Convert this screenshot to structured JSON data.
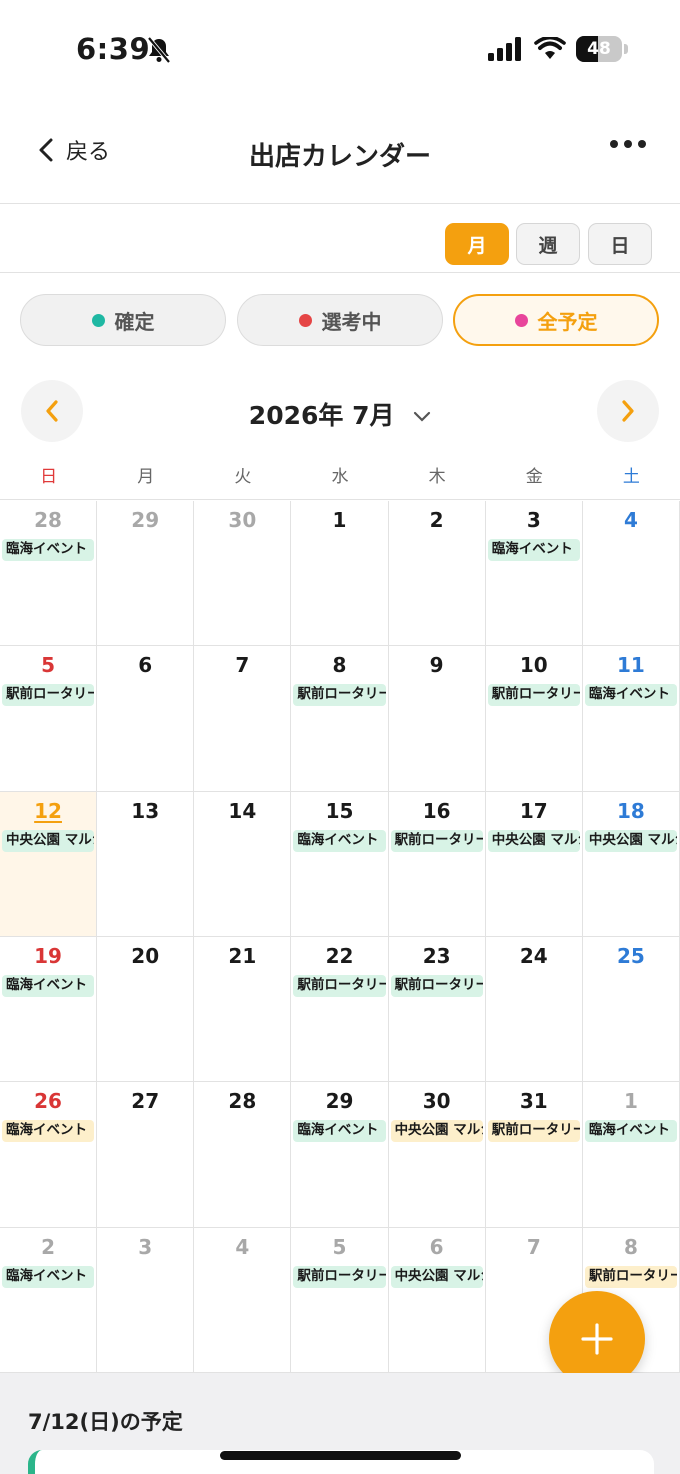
{
  "status_bar": {
    "time": "6:39",
    "battery": "48",
    "battery_level": 0.48
  },
  "nav": {
    "back_label": "戻る",
    "title": "出店カレンダー"
  },
  "view_switch": {
    "month": "月",
    "week": "週",
    "day": "日",
    "selected": "月"
  },
  "filters": [
    {
      "label": "確定",
      "color": "#1fb8a3",
      "active": false
    },
    {
      "label": "選考中",
      "color": "#e54545",
      "active": false
    },
    {
      "label": "全予定",
      "color": "#e8459b",
      "active": true
    }
  ],
  "month_header": {
    "title": "2026年 7月"
  },
  "weekdays": [
    "日",
    "月",
    "火",
    "水",
    "木",
    "金",
    "土"
  ],
  "colors": {
    "accent": "#f4a00f",
    "event_green": "#d8f3e6",
    "event_yellow": "#fdefcb",
    "sunday": "#d93636",
    "saturday": "#2e7bd6"
  },
  "calendar": [
    [
      {
        "day": "28",
        "out": true,
        "ev": "臨海イベント",
        "evc": "green"
      },
      {
        "day": "29",
        "out": true
      },
      {
        "day": "30",
        "out": true
      },
      {
        "day": "1"
      },
      {
        "day": "2"
      },
      {
        "day": "3",
        "ev": "臨海イベント",
        "evc": "green"
      },
      {
        "day": "4"
      }
    ],
    [
      {
        "day": "5",
        "ev": "駅前ロータリー",
        "evc": "green"
      },
      {
        "day": "6"
      },
      {
        "day": "7"
      },
      {
        "day": "8",
        "ev": "駅前ロータリー",
        "evc": "green"
      },
      {
        "day": "9"
      },
      {
        "day": "10",
        "ev": "駅前ロータリー",
        "evc": "green"
      },
      {
        "day": "11",
        "ev": "臨海イベント",
        "evc": "green"
      }
    ],
    [
      {
        "day": "12",
        "today": true,
        "ev": "中央公園 マルシェ",
        "evc": "green"
      },
      {
        "day": "13"
      },
      {
        "day": "14"
      },
      {
        "day": "15",
        "ev": "臨海イベント",
        "evc": "green"
      },
      {
        "day": "16",
        "ev": "駅前ロータリー",
        "evc": "green"
      },
      {
        "day": "17",
        "ev": "中央公園 マルシェ",
        "evc": "green"
      },
      {
        "day": "18",
        "ev": "中央公園 マルシェ",
        "evc": "green"
      }
    ],
    [
      {
        "day": "19",
        "ev": "臨海イベント",
        "evc": "green"
      },
      {
        "day": "20"
      },
      {
        "day": "21"
      },
      {
        "day": "22",
        "ev": "駅前ロータリー",
        "evc": "green"
      },
      {
        "day": "23",
        "ev": "駅前ロータリー",
        "evc": "green"
      },
      {
        "day": "24"
      },
      {
        "day": "25"
      }
    ],
    [
      {
        "day": "26",
        "ev": "臨海イベント",
        "evc": "yellow"
      },
      {
        "day": "27"
      },
      {
        "day": "28"
      },
      {
        "day": "29",
        "ev": "臨海イベント",
        "evc": "green"
      },
      {
        "day": "30",
        "ev": "中央公園 マルシェ",
        "evc": "yellow"
      },
      {
        "day": "31",
        "ev": "駅前ロータリー",
        "evc": "yellow"
      },
      {
        "day": "1",
        "out": true,
        "ev": "臨海イベント",
        "evc": "green"
      }
    ],
    [
      {
        "day": "2",
        "out": true,
        "ev": "臨海イベント",
        "evc": "green"
      },
      {
        "day": "3",
        "out": true
      },
      {
        "day": "4",
        "out": true
      },
      {
        "day": "5",
        "out": true,
        "ev": "駅前ロータリー",
        "evc": "green"
      },
      {
        "day": "6",
        "out": true,
        "ev": "中央公園 マルシェ",
        "evc": "green"
      },
      {
        "day": "7",
        "out": true
      },
      {
        "day": "8",
        "out": true,
        "ev": "駅前ロータリー",
        "evc": "yellow"
      }
    ]
  ],
  "selected_day": {
    "heading": "7/12(日)の予定"
  }
}
